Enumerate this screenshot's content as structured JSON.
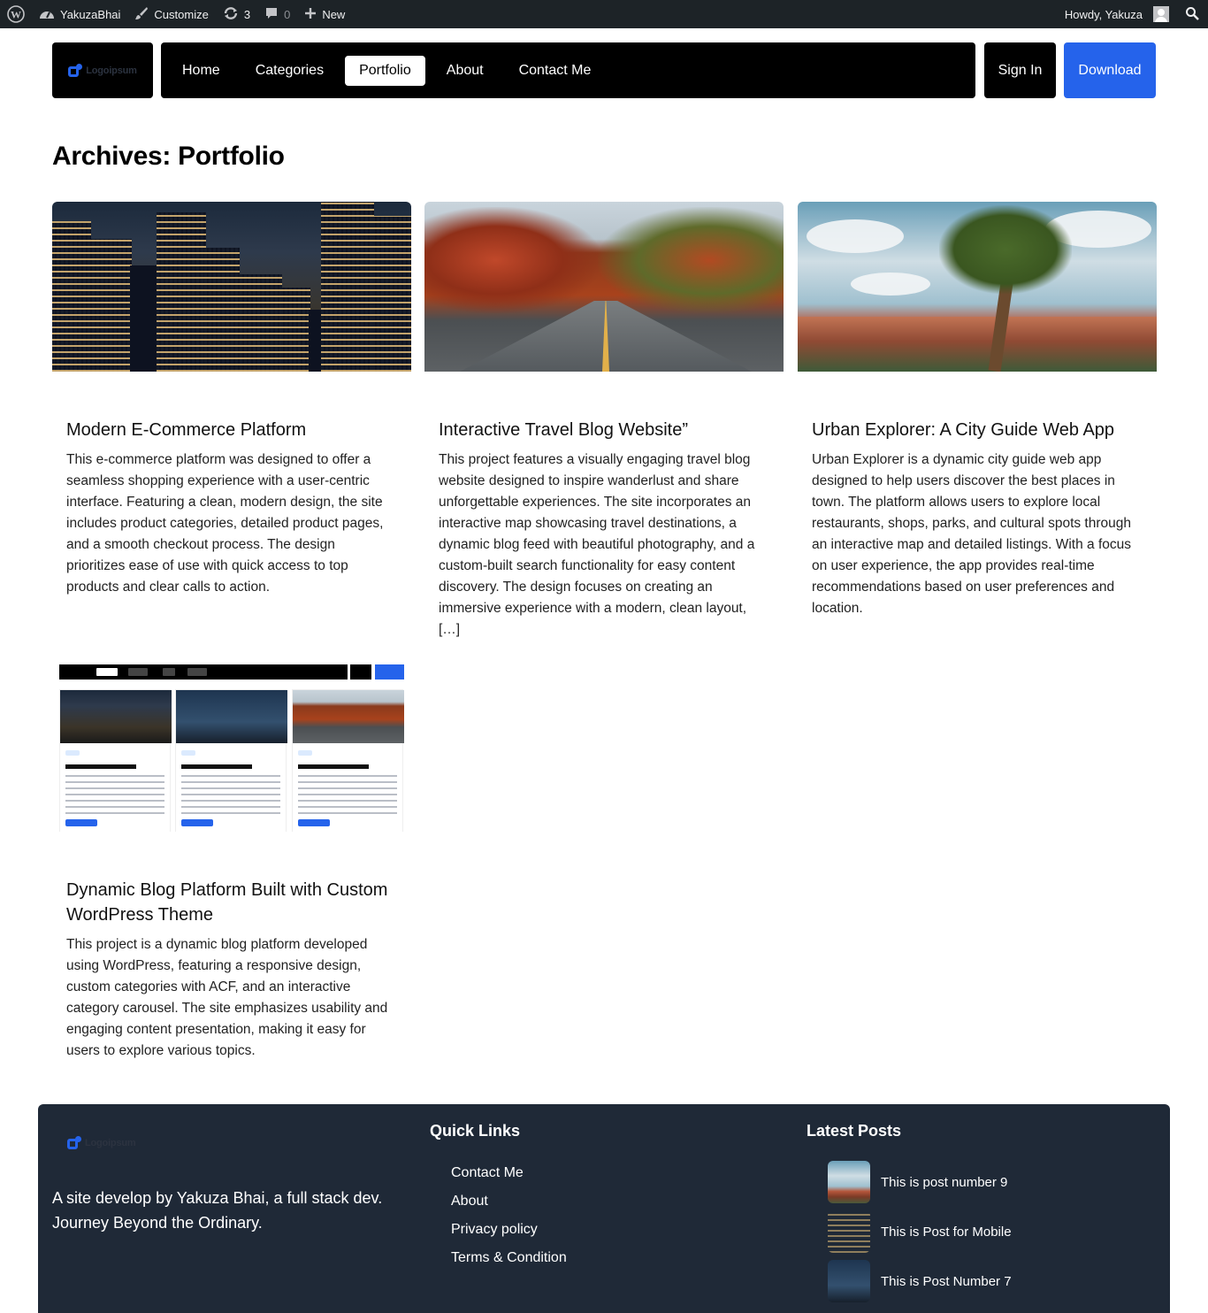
{
  "admin_bar": {
    "site_name": "YakuzaBhai",
    "customize": "Customize",
    "updates": "3",
    "comments": "0",
    "new": "New",
    "howdy": "Howdy, Yakuza"
  },
  "header": {
    "logo_text": "Logoipsum",
    "nav": [
      "Home",
      "Categories",
      "Portfolio",
      "About",
      "Contact Me"
    ],
    "active_nav": "Portfolio",
    "sign_in": "Sign In",
    "download": "Download"
  },
  "page": {
    "title": "Archives: Portfolio"
  },
  "cards": [
    {
      "title": "Modern E-Commerce Platform",
      "description": "This e-commerce platform was designed to offer a seamless shopping experience with a user-centric interface. Featuring a clean, modern design, the site includes product categories, detailed product pages, and a smooth checkout process. The design prioritizes ease of use with quick access to top products and clear calls to action."
    },
    {
      "title": "Interactive Travel Blog Website”",
      "description": "This project features a visually engaging travel blog website designed to inspire wanderlust and share unforgettable experiences. The site incorporates an interactive map showcasing travel destinations, a dynamic blog feed with beautiful photography, and a custom-built search functionality for easy content discovery. The design focuses on creating an immersive experience with a modern, clean layout, […]"
    },
    {
      "title": "Urban Explorer: A City Guide Web App",
      "description": "Urban Explorer is a dynamic city guide web app designed to help users discover the best places in town. The platform allows users to explore local restaurants, shops, parks, and cultural spots through an interactive map and detailed listings. With a focus on user experience, the app provides real-time recommendations based on user preferences and location."
    },
    {
      "title": "Dynamic Blog Platform Built with Custom WordPress Theme",
      "description": "This project is a dynamic blog platform developed using WordPress, featuring a responsive design, custom categories with ACF, and an interactive category carousel. The site emphasizes usability and engaging content presentation, making it easy for users to explore various topics."
    }
  ],
  "footer": {
    "logo_text": "Logoipsum",
    "tagline": "A site develop by Yakuza Bhai, a full stack dev. Journey Beyond the Ordinary.",
    "quick_links_title": "Quick Links",
    "quick_links": [
      "Contact Me",
      "About",
      "Privacy policy",
      "Terms & Condition"
    ],
    "latest_posts_title": "Latest Posts",
    "latest_posts": [
      "This is post number 9",
      "This is Post for Mobile",
      "This is Post Number 7"
    ]
  },
  "colors": {
    "accent": "#2563eb",
    "admin_bar": "#1d2327",
    "footer_bg": "#1f2937"
  }
}
